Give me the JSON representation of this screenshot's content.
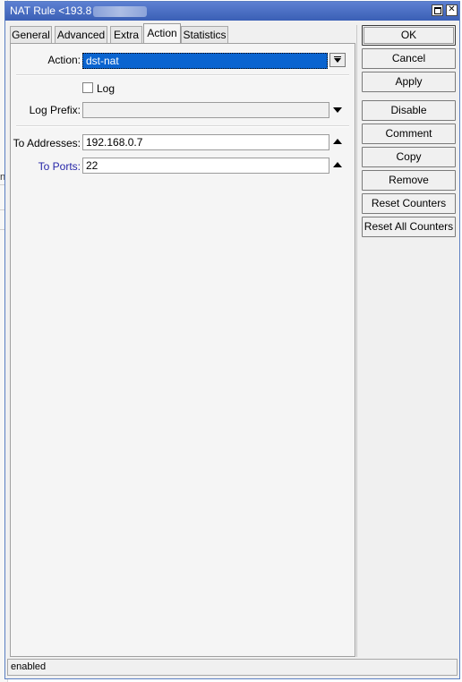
{
  "window": {
    "title": "NAT Rule <193.8"
  },
  "tabs": [
    {
      "label": "General"
    },
    {
      "label": "Advanced"
    },
    {
      "label": "Extra"
    },
    {
      "label": "Action"
    },
    {
      "label": "Statistics"
    }
  ],
  "active_tab": "Action",
  "form": {
    "action": {
      "label": "Action:",
      "value": "dst-nat"
    },
    "log": {
      "label": "Log",
      "checked": false
    },
    "log_prefix": {
      "label": "Log Prefix:",
      "value": ""
    },
    "to_addresses": {
      "label": "To Addresses:",
      "value": "192.168.0.7"
    },
    "to_ports": {
      "label": "To Ports:",
      "value": "22"
    }
  },
  "buttons": {
    "ok": "OK",
    "cancel": "Cancel",
    "apply": "Apply",
    "disable": "Disable",
    "comment": "Comment",
    "copy": "Copy",
    "remove": "Remove",
    "reset_counters": "Reset Counters",
    "reset_all_counters": "Reset All Counters"
  },
  "status": {
    "text": "enabled"
  },
  "background": {
    "fragment": "ns"
  },
  "colors": {
    "titlebar": "#3a5fb5",
    "selection": "#0a64d0",
    "label_link": "#2525a8"
  }
}
